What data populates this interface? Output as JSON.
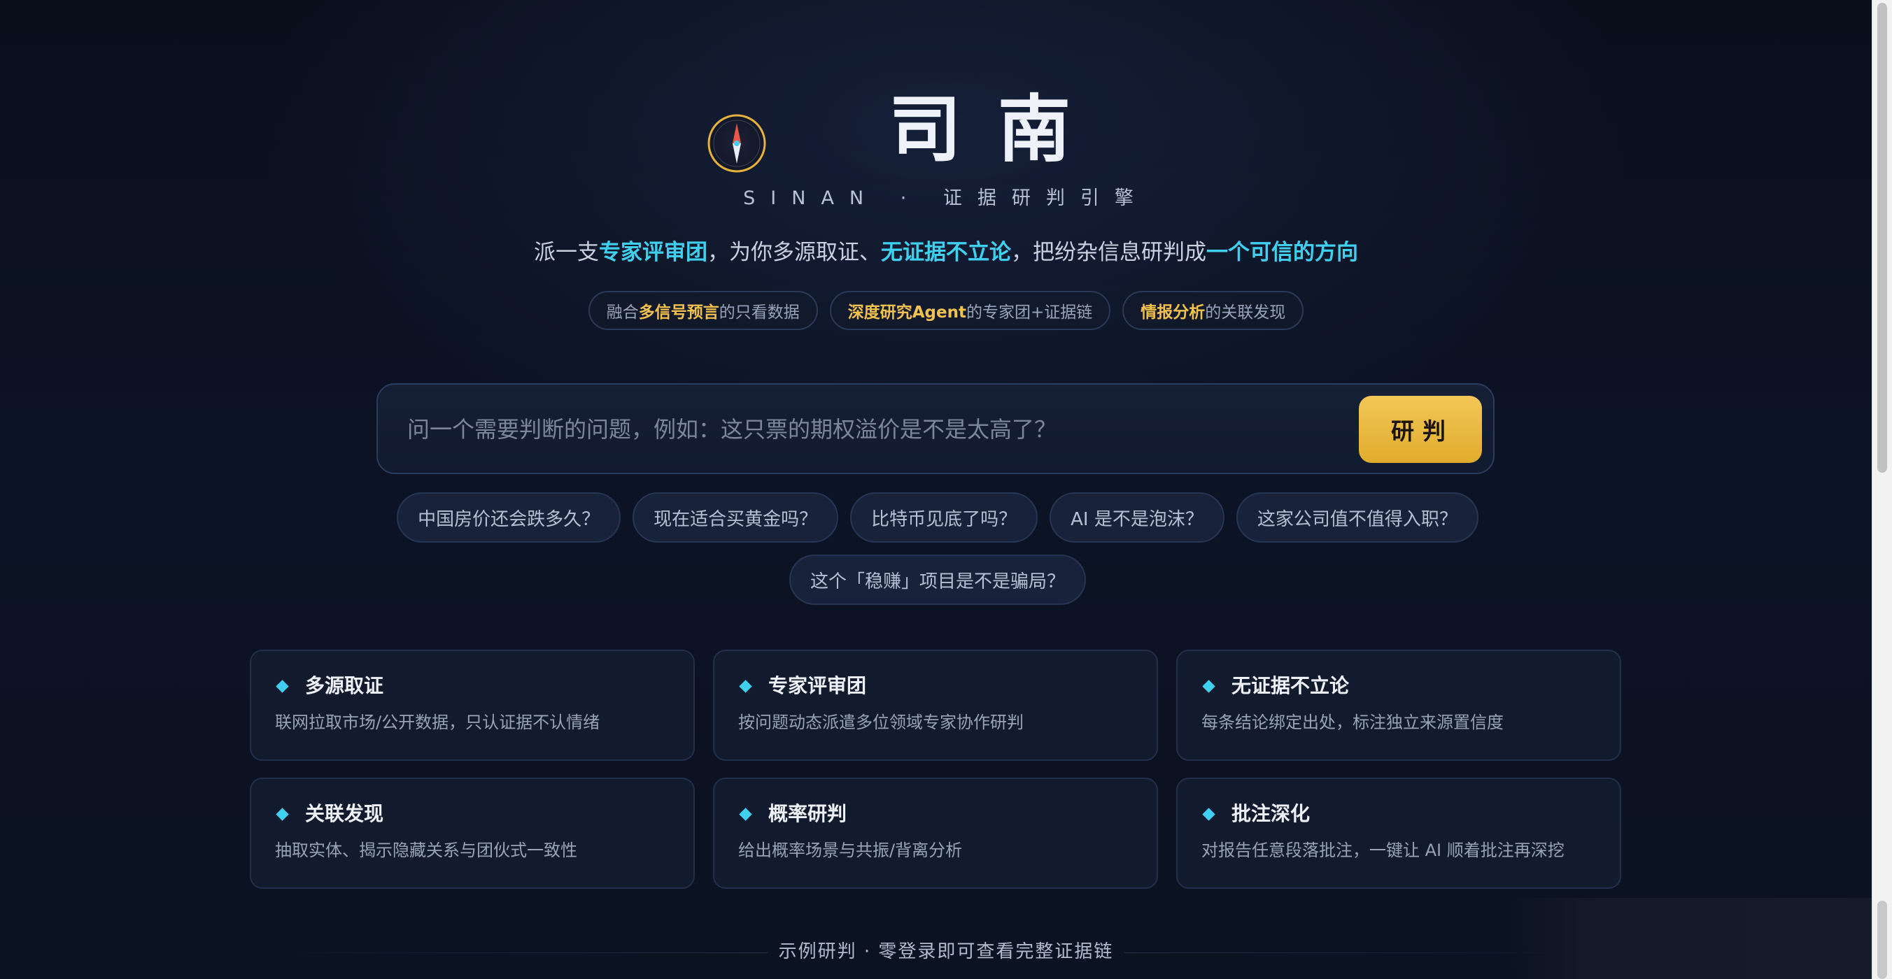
{
  "brand": {
    "title": "司南",
    "subtitle": "SINAN · 证据研判引擎"
  },
  "tagline": {
    "p1": "派一支",
    "h1": "专家评审团",
    "p2": "，为你多源取证、",
    "h2": "无证据不立论",
    "p3": "，把纷杂信息研判成",
    "h3": "一个可信的方向"
  },
  "pills": [
    {
      "prefix": "融合 ",
      "highlight": "多信号预言",
      "suffix": " 的只看数据"
    },
    {
      "prefix": "",
      "highlight": "深度研究Agent",
      "suffix": " 的专家团+证据链"
    },
    {
      "prefix": "",
      "highlight": "情报分析",
      "suffix": " 的关联发现"
    }
  ],
  "search": {
    "placeholder": "问一个需要判断的问题，例如：这只票的期权溢价是不是太高了？",
    "submit_label": "研判"
  },
  "suggestions": [
    "中国房价还会跌多久？",
    "现在适合买黄金吗？",
    "比特币见底了吗？",
    "AI 是不是泡沫？",
    "这家公司值不值得入职？",
    "这个「稳赚」项目是不是骗局？"
  ],
  "features": [
    {
      "title": "多源取证",
      "desc": "联网拉取市场/公开数据，只认证据不认情绪"
    },
    {
      "title": "专家评审团",
      "desc": "按问题动态派遣多位领域专家协作研判"
    },
    {
      "title": "无证据不立论",
      "desc": "每条结论绑定出处，标注独立来源置信度"
    },
    {
      "title": "关联发现",
      "desc": "抽取实体、揭示隐藏关系与团伙式一致性"
    },
    {
      "title": "概率研判",
      "desc": "给出概率场景与共振/背离分析"
    },
    {
      "title": "批注深化",
      "desc": "对报告任意段落批注，一键让 AI 顺着批注再深挖"
    }
  ],
  "footer": {
    "text": "示例研判 · 零登录即可查看完整证据链"
  },
  "colors": {
    "accent_cyan": "#3fd0f0",
    "accent_gold": "#f2c14e",
    "background": "#0b1120"
  },
  "icons": {
    "logo": "compass-icon",
    "feature_bullet": "diamond-icon"
  }
}
